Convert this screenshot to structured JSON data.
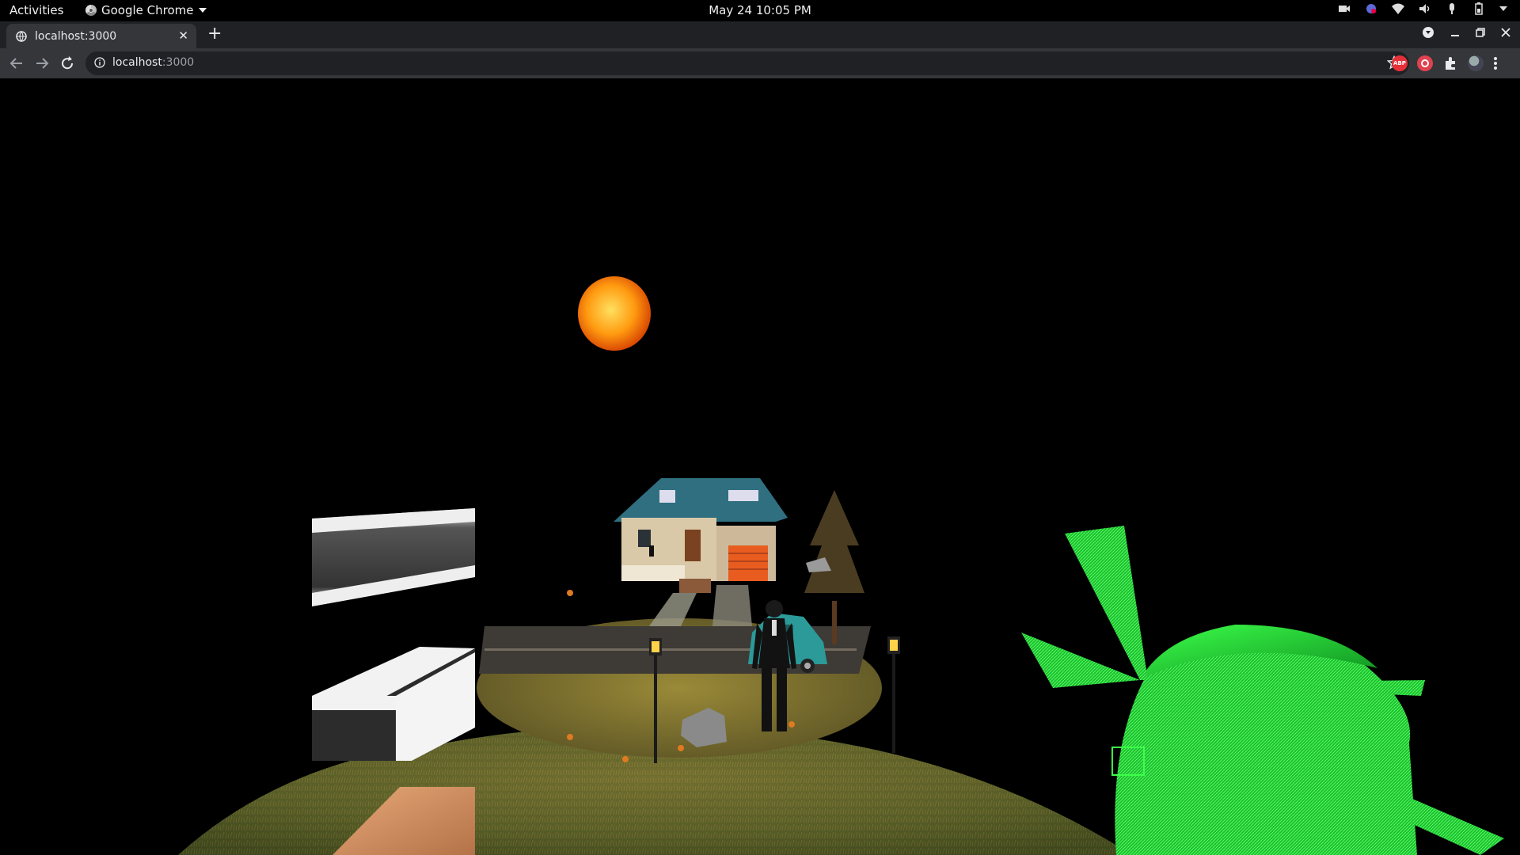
{
  "system_bar": {
    "activities": "Activities",
    "app_name": "Google Chrome",
    "clock": "May 24  10:05 PM"
  },
  "browser": {
    "tab_title": "localhost:3000",
    "url_host": "localhost",
    "url_port": ":3000",
    "extensions": {
      "abp_label": "ABP"
    }
  },
  "colors": {
    "sky": "#000000",
    "moon": "#ff8a00",
    "grass": "#5d6b2a",
    "windmill": "#22e33a",
    "house_roof": "#2f6f7f",
    "garage_door": "#e85d1f"
  },
  "icons": [
    "chrome-icon",
    "dropdown-icon",
    "camera-icon",
    "notification-icon",
    "wifi-icon",
    "volume-icon",
    "microphone-icon",
    "battery-icon",
    "globe-icon",
    "close-icon",
    "plus-icon",
    "profile-icon",
    "minimize-icon",
    "restore-icon",
    "back-icon",
    "forward-icon",
    "reload-icon",
    "info-icon",
    "star-icon",
    "abp-icon",
    "record-icon",
    "puzzle-icon",
    "avatar-icon",
    "kebab-menu-icon"
  ]
}
